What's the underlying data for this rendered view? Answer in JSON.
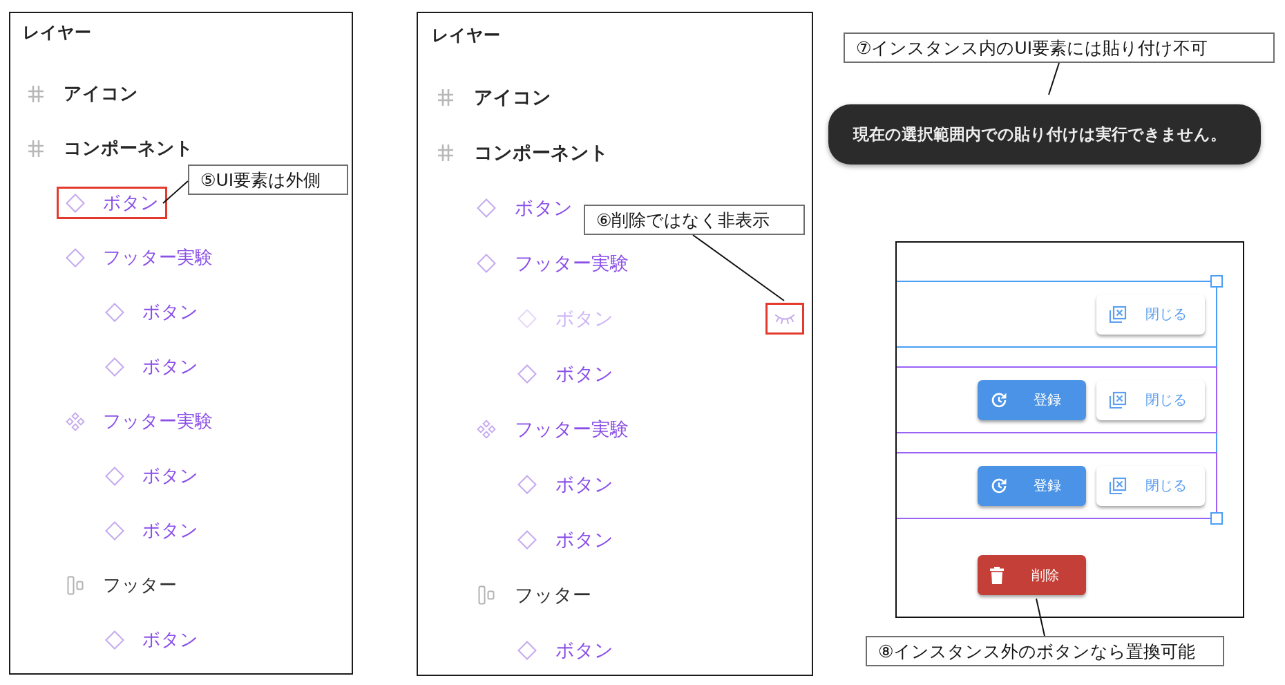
{
  "layer_panels": [
    {
      "title": "レイヤー",
      "layers": [
        {
          "kind": "frame",
          "name": "アイコン",
          "hidden": false,
          "highlighted": false
        },
        {
          "kind": "frame",
          "name": "コンポーネント",
          "hidden": false,
          "highlighted": false,
          "children": [
            {
              "kind": "instance",
              "name": "ボタン",
              "hidden": false,
              "highlighted": true
            },
            {
              "kind": "instance",
              "name": "フッター実験",
              "hidden": false,
              "highlighted": false,
              "children": [
                {
                  "kind": "instance",
                  "name": "ボタン",
                  "hidden": false,
                  "highlighted": false
                },
                {
                  "kind": "instance",
                  "name": "ボタン",
                  "hidden": false,
                  "highlighted": false
                }
              ]
            },
            {
              "kind": "component",
              "name": "フッター実験",
              "hidden": false,
              "highlighted": false,
              "children": [
                {
                  "kind": "instance",
                  "name": "ボタン",
                  "hidden": false,
                  "highlighted": false
                },
                {
                  "kind": "instance",
                  "name": "ボタン",
                  "hidden": false,
                  "highlighted": false
                }
              ]
            },
            {
              "kind": "autolayout",
              "name": "フッター",
              "hidden": false,
              "highlighted": false,
              "children": [
                {
                  "kind": "instance",
                  "name": "ボタン",
                  "hidden": false,
                  "highlighted": false
                }
              ]
            }
          ]
        }
      ],
      "callout": "⑤UI要素は外側"
    },
    {
      "title": "レイヤー",
      "layers": [
        {
          "kind": "frame",
          "name": "アイコン",
          "hidden": false,
          "highlighted": false
        },
        {
          "kind": "frame",
          "name": "コンポーネント",
          "hidden": false,
          "highlighted": false,
          "children": [
            {
              "kind": "instance",
              "name": "ボタン",
              "hidden": false,
              "highlighted": false
            },
            {
              "kind": "instance",
              "name": "フッター実験",
              "hidden": false,
              "highlighted": false,
              "children": [
                {
                  "kind": "instance",
                  "name": "ボタン",
                  "hidden": true,
                  "highlighted": true
                },
                {
                  "kind": "instance",
                  "name": "ボタン",
                  "hidden": false,
                  "highlighted": false
                }
              ]
            },
            {
              "kind": "component",
              "name": "フッター実験",
              "hidden": false,
              "highlighted": false,
              "children": [
                {
                  "kind": "instance",
                  "name": "ボタン",
                  "hidden": false,
                  "highlighted": false
                },
                {
                  "kind": "instance",
                  "name": "ボタン",
                  "hidden": false,
                  "highlighted": false
                }
              ]
            },
            {
              "kind": "autolayout",
              "name": "フッター",
              "hidden": false,
              "highlighted": false,
              "children": [
                {
                  "kind": "instance",
                  "name": "ボタン",
                  "hidden": false,
                  "highlighted": false
                }
              ]
            }
          ]
        }
      ],
      "callout": "⑥削除ではなく非表示"
    }
  ],
  "paste_example": {
    "callout": "⑦インスタンス内のUI要素には貼り付け不可",
    "toast": "現在の選択範囲内での貼り付けは実行できません。"
  },
  "canvas": {
    "selected": true,
    "rows": [
      {
        "kind": "frame",
        "buttons": [
          {
            "kind": "secondary",
            "label": "閉じる"
          }
        ]
      },
      {
        "kind": "instance",
        "buttons": [
          {
            "kind": "primary",
            "label": "登録"
          },
          {
            "kind": "secondary",
            "label": "閉じる"
          }
        ]
      },
      {
        "kind": "instance",
        "buttons": [
          {
            "kind": "primary",
            "label": "登録"
          },
          {
            "kind": "secondary",
            "label": "閉じる"
          }
        ]
      }
    ],
    "buttons_below": [
      {
        "kind": "danger",
        "label": "削除"
      }
    ],
    "callout": "⑧インスタンス外のボタンなら置換可能"
  }
}
